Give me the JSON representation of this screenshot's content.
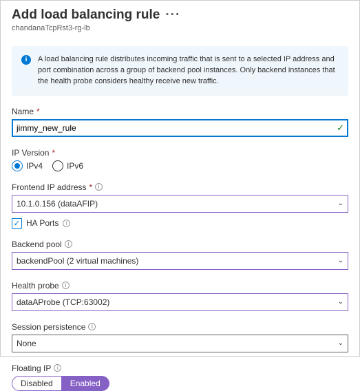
{
  "header": {
    "title": "Add load balancing rule",
    "subtitle": "chandanaTcpRst3-rg-lb"
  },
  "info": "A load balancing rule distributes incoming traffic that is sent to a selected IP address and port combination across a group of backend pool instances. Only backend instances that the health probe considers healthy receive new traffic.",
  "fields": {
    "name": {
      "label": "Name",
      "value": "jimmy_new_rule"
    },
    "ipversion": {
      "label": "IP Version",
      "opt1": "IPv4",
      "opt2": "IPv6"
    },
    "frontend": {
      "label": "Frontend IP address",
      "value": "10.1.0.156 (dataAFIP)"
    },
    "haports": {
      "label": "HA Ports"
    },
    "backend": {
      "label": "Backend pool",
      "value": "backendPool (2 virtual machines)"
    },
    "probe": {
      "label": "Health probe",
      "value": "dataAProbe (TCP:63002)"
    },
    "session": {
      "label": "Session persistence",
      "value": "None"
    },
    "floating": {
      "label": "Floating IP",
      "disabled": "Disabled",
      "enabled": "Enabled"
    }
  }
}
